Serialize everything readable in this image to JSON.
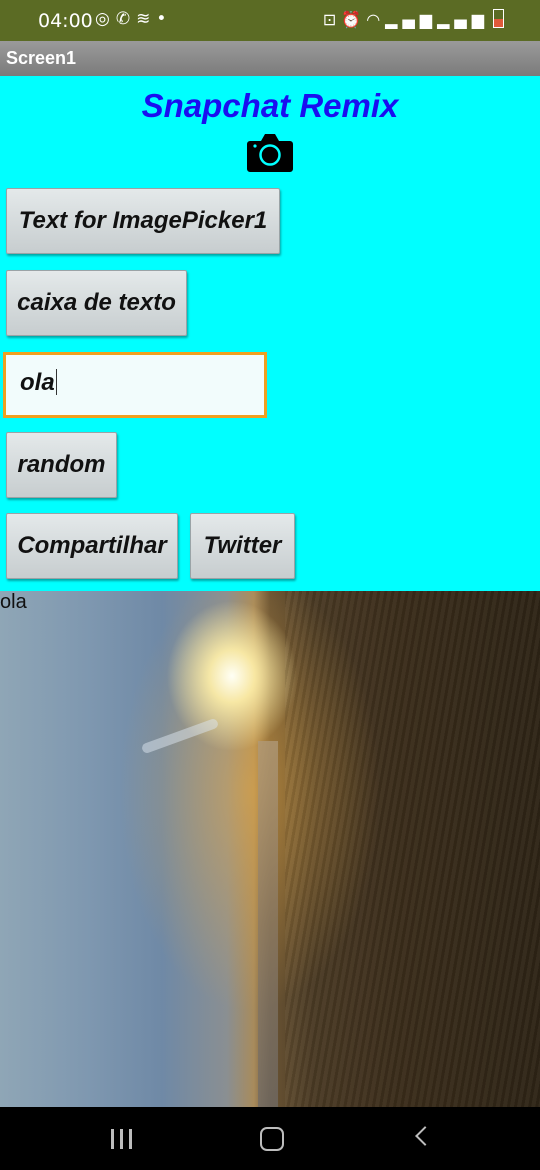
{
  "status_bar": {
    "time": "04:00",
    "left_icons": [
      "whatsapp-icon",
      "call-missed-icon",
      "app-notification-icon",
      "dot-icon"
    ],
    "right_icons": [
      "lock-icon",
      "alarm-icon",
      "wifi-icon",
      "signal-icon",
      "signal-icon",
      "battery-icon"
    ]
  },
  "title_bar": {
    "title": "Screen1"
  },
  "app": {
    "title": "Snapchat Remix",
    "title_color": "#1a0ff0",
    "background_color": "#00ffff",
    "camera_icon": "camera-icon",
    "buttons": {
      "image_picker": "Text for ImagePicker1",
      "text_box": "caixa de texto",
      "random": "random",
      "share": "Compartilhar",
      "twitter": "Twitter"
    },
    "text_input": {
      "value": "ola"
    },
    "photo_caption": "ola"
  },
  "nav_bar": {
    "recent": "recent-apps-icon",
    "home": "home-icon",
    "back": "back-icon"
  }
}
